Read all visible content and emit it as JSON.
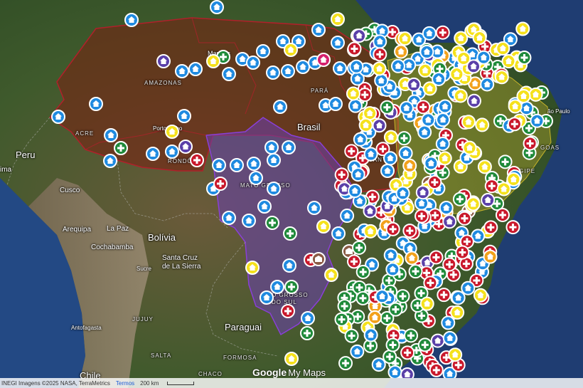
{
  "map": {
    "country_labels": [
      {
        "name": "brasil-label",
        "text": "Brasil"
      },
      {
        "name": "peru-label",
        "text": "Peru"
      },
      {
        "name": "bolivia-label",
        "text": "Bolívia"
      },
      {
        "name": "paraguai-label",
        "text": "Paraguai"
      },
      {
        "name": "chile-label",
        "text": "Chile"
      }
    ],
    "city_labels": [
      {
        "name": "la-paz-label",
        "text": "La Paz"
      },
      {
        "name": "cochabamba-label",
        "text": "Cochabamba"
      },
      {
        "name": "cusco-label",
        "text": "Cusco"
      },
      {
        "name": "arequipa-label",
        "text": "Arequipa"
      },
      {
        "name": "santa-cruz-label",
        "text": "Santa Cruz\nde La Sierra"
      },
      {
        "name": "sucre-label",
        "text": "Sucre"
      },
      {
        "name": "antofagasta-label",
        "text": "Antofagasta"
      },
      {
        "name": "lima-label",
        "text": "ima"
      },
      {
        "name": "manaus-label",
        "text": "Manaus"
      },
      {
        "name": "porto-velho-label",
        "text": "Porto Velho"
      },
      {
        "name": "sao-paulo-label",
        "text": "ão Paulo"
      }
    ],
    "region_labels": [
      {
        "name": "amazonas-label",
        "text": "AMAZONAS"
      },
      {
        "name": "para-label",
        "text": "PARÁ"
      },
      {
        "name": "acre-label",
        "text": "ACRE"
      },
      {
        "name": "rondonia-label",
        "text": "RONDÔ"
      },
      {
        "name": "mato-grosso-label",
        "text": "MATO GROSSO"
      },
      {
        "name": "mato-grosso-do-sul-label",
        "text": "O GROSSO\nDO SUL"
      },
      {
        "name": "tocantins-label",
        "text": "TOCANTINS"
      },
      {
        "name": "alagoas-label",
        "text": "GOAS"
      },
      {
        "name": "sergipe-label",
        "text": "GIPE"
      },
      {
        "name": "jujuy-label",
        "text": "JUJUY"
      },
      {
        "name": "salta-label",
        "text": "SALTA"
      },
      {
        "name": "formosa-label",
        "text": "FORMOSA"
      },
      {
        "name": "chaco-label",
        "text": "CHACO"
      }
    ],
    "marker_legend": {
      "blue": "#1f8ae0",
      "red": "#c9182b",
      "green": "#1f8a3a",
      "yellow": "#f5e11c",
      "orange": "#f2a11b",
      "purple": "#5a3fa8",
      "brown": "#8a5a44",
      "pink": "#d61f6d"
    },
    "marker_icons": {
      "blue": "house-icon",
      "red": "plus-icon",
      "green": "plus-icon",
      "yellow": "house-icon",
      "orange": "house-icon",
      "purple": "house-icon",
      "brown": "building-icon",
      "pink": "house-icon"
    }
  },
  "footer": {
    "attribution": "INEGI Imagens ©2025 NASA, TerraMetrics",
    "terms": "Termos",
    "scale": "200 km"
  },
  "logo": {
    "google": "Google",
    "mymaps": "My Maps"
  }
}
